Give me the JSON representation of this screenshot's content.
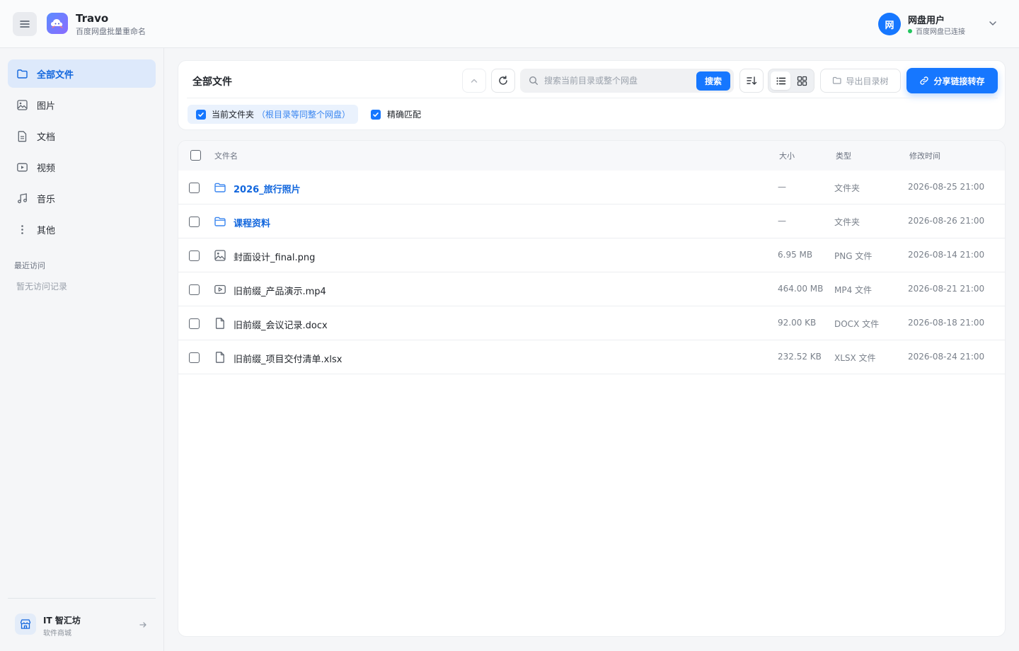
{
  "header": {
    "app_title": "Travo",
    "app_subtitle": "百度网盘批量重命名",
    "user": {
      "avatar_text": "网",
      "name": "网盘用户",
      "status": "百度网盘已连接"
    }
  },
  "sidebar": {
    "items": [
      {
        "label": "全部文件",
        "icon": "folder-icon",
        "active": true
      },
      {
        "label": "图片",
        "icon": "image-icon"
      },
      {
        "label": "文档",
        "icon": "document-icon"
      },
      {
        "label": "视频",
        "icon": "video-icon"
      },
      {
        "label": "音乐",
        "icon": "music-icon"
      },
      {
        "label": "其他",
        "icon": "more-vertical-icon"
      }
    ],
    "recent_title": "最近访问",
    "recent_empty": "暂无访问记录",
    "store": {
      "name": "IT 智汇坊",
      "subtitle": "软件商城"
    }
  },
  "toolbar": {
    "title": "全部文件",
    "search_placeholder": "搜索当前目录或整个网盘",
    "search_value": "",
    "search_button": "搜索",
    "export_label": "导出目录树",
    "share_label": "分享链接转存",
    "scope_label": "当前文件夹",
    "scope_hint": "（根目录等同整个网盘）",
    "scope_checked": true,
    "exact_label": "精确匹配",
    "exact_checked": true
  },
  "table": {
    "headers": {
      "name": "文件名",
      "size": "大小",
      "type": "类型",
      "modified": "修改时间"
    },
    "rows": [
      {
        "name": "2026_旅行照片",
        "size": "—",
        "type": "文件夹",
        "modified": "2026-08-25 21:00",
        "icon": "folder-icon",
        "is_folder": true
      },
      {
        "name": "课程资料",
        "size": "—",
        "type": "文件夹",
        "modified": "2026-08-26 21:00",
        "icon": "folder-icon",
        "is_folder": true
      },
      {
        "name": "封面设计_final.png",
        "size": "6.95 MB",
        "type": "PNG 文件",
        "modified": "2026-08-14 21:00",
        "icon": "image-icon",
        "is_folder": false
      },
      {
        "name": "旧前缀_产品演示.mp4",
        "size": "464.00 MB",
        "type": "MP4 文件",
        "modified": "2026-08-21 21:00",
        "icon": "video-icon",
        "is_folder": false
      },
      {
        "name": "旧前缀_会议记录.docx",
        "size": "92.00 KB",
        "type": "DOCX 文件",
        "modified": "2026-08-18 21:00",
        "icon": "document-icon",
        "is_folder": false
      },
      {
        "name": "旧前缀_项目交付清单.xlsx",
        "size": "232.52 KB",
        "type": "XLSX 文件",
        "modified": "2026-08-24 21:00",
        "icon": "document-icon",
        "is_folder": false
      }
    ]
  },
  "colors": {
    "accent": "#1677ff",
    "folder_text": "#1166dd",
    "active_nav_bg": "#dde9fb",
    "status_online": "#22c55e"
  }
}
